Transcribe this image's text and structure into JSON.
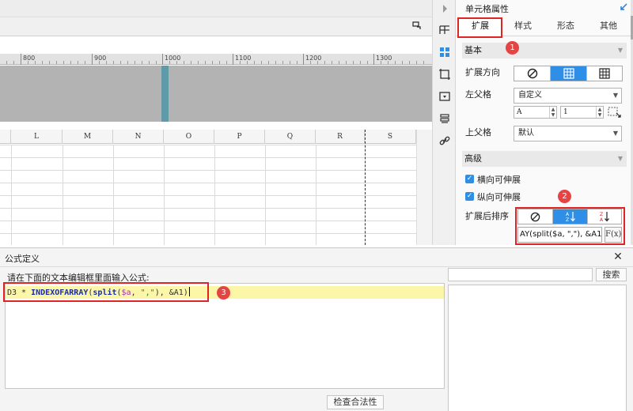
{
  "ruler": {
    "labels": [
      "800",
      "900",
      "1000",
      "1100",
      "1200",
      "1300"
    ]
  },
  "columns": [
    "L",
    "M",
    "N",
    "O",
    "P",
    "Q",
    "R",
    "S"
  ],
  "icons": {
    "tab_strip_control": "pin-icon",
    "sidebar": [
      "panel-expand-icon",
      "layout-icon",
      "cell-properties-icon",
      "crop-icon",
      "widget-icon",
      "stack-icon",
      "link-icon"
    ]
  },
  "panel": {
    "title": "单元格属性",
    "tabs": [
      "扩展",
      "样式",
      "形态",
      "其他"
    ],
    "active_tab": "扩展",
    "basic": {
      "header": "基本",
      "expand_direction_label": "扩展方向",
      "left_parent_label": "左父格",
      "left_parent_value": "自定义",
      "left_parent_col": "A",
      "left_parent_row": "1",
      "upper_parent_label": "上父格",
      "upper_parent_value": "默认"
    },
    "advanced": {
      "header": "高级",
      "horizontal_expandable": "横向可伸展",
      "vertical_expandable": "纵向可伸展",
      "sort_label": "扩展后排序",
      "sort_formula": "AY(split($a, \",\"), &A1)",
      "fx_label": "F(x)"
    }
  },
  "dialog": {
    "title": "公式定义",
    "instruction": "请在下面的文本编辑框里面输入公式:",
    "formula": {
      "ref": "D3 * ",
      "fn1": "INDEXOFARRAY",
      "p1": "(",
      "fn2": "split",
      "p2": "(",
      "var": "$a",
      "p3": ", ",
      "str": "\",\"",
      "p4": "), &A1)"
    },
    "search_button": "搜索",
    "check_button": "检查合法性"
  },
  "annotations": [
    "1",
    "2",
    "3"
  ],
  "colors": {
    "accent_blue": "#2f8ee5",
    "annotation_red": "#e02424",
    "highlight_line": "#fbf6a8",
    "preview_marker": "#5e9aa8"
  }
}
